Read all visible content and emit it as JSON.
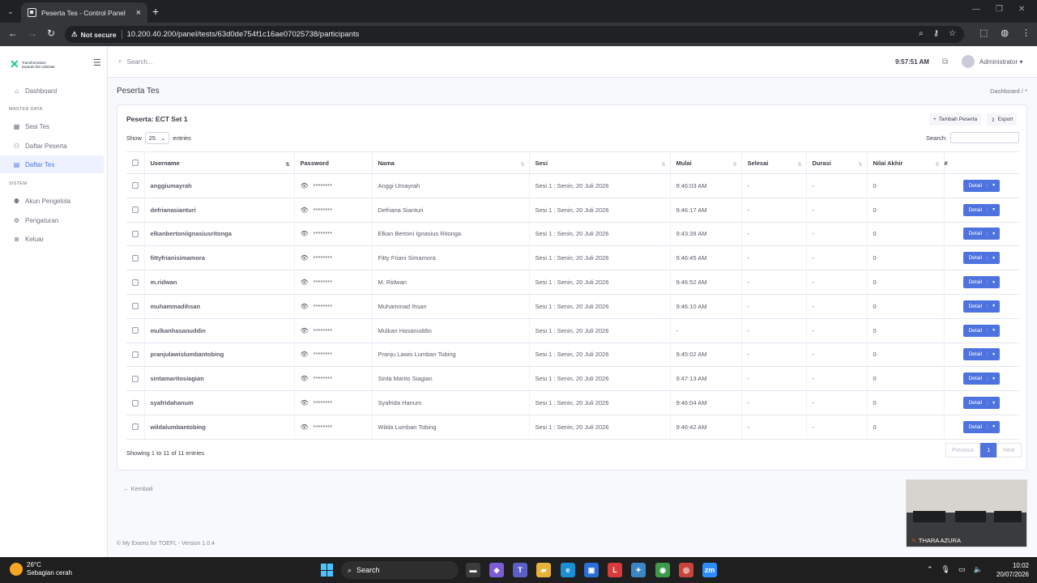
{
  "browser": {
    "tab_title": "Peserta Tes - Control Panel",
    "not_secure": "Not secure",
    "url": "10.200.40.200/panel/tests/63d0de754f1c16ae07025738/participants"
  },
  "sidebar": {
    "logo_line1": "Transformation",
    "logo_line2": "towards the Ultimate",
    "items": [
      {
        "label": "Dashboard",
        "icon": "home-icon"
      },
      {
        "label": "Sesi Tes",
        "icon": "calendar-icon"
      },
      {
        "label": "Daftar Peserta",
        "icon": "users-icon"
      },
      {
        "label": "Daftar Tes",
        "icon": "calendar-check-icon"
      },
      {
        "label": "Akun Pengelola",
        "icon": "user-cog-icon"
      },
      {
        "label": "Pengaturan",
        "icon": "gear-icon"
      },
      {
        "label": "Keluar",
        "icon": "logout-icon"
      }
    ],
    "heading_master": "MASTER DATA",
    "heading_system": "SISTEM"
  },
  "topbar": {
    "search_placeholder": "Search...",
    "clock": "9:57:51 AM",
    "user": "Administrator"
  },
  "page": {
    "title": "Peserta Tes",
    "breadcrumb": "Dashboard  /  *",
    "card_title": "Peserta: ECT Set 1",
    "add_button": "Tambah Peserta",
    "export_button": "Export",
    "show_label": "Show",
    "entries_value": "25",
    "entries_label": "entries",
    "search_label": "Search:",
    "info": "Showing 1 to 11 of 11 entries",
    "prev": "Previous",
    "page_no": "1",
    "next": "Next",
    "back": "Kembali",
    "footer": "© My Exams for TOEFL - Version 1.0.4"
  },
  "table": {
    "headers": [
      "Username",
      "Password",
      "Nama",
      "Sesi",
      "Mulai",
      "Selesai",
      "Durasi",
      "Nilai Akhir",
      "#"
    ],
    "detail_label": "Detail",
    "rows": [
      {
        "username": "anggiumayrah",
        "password": "********",
        "nama": "Anggi Umayrah",
        "sesi": "Sesi 1 : Senin, 20 Juli 2026",
        "mulai": "9:46:03 AM",
        "selesai": "-",
        "durasi": "-",
        "nilai": "0"
      },
      {
        "username": "defrianasianturi",
        "password": "********",
        "nama": "Defriana Sianturi",
        "sesi": "Sesi 1 : Senin, 20 Juli 2026",
        "mulai": "9:46:17 AM",
        "selesai": "-",
        "durasi": "-",
        "nilai": "0"
      },
      {
        "username": "elkanbertoniignasiusritonga",
        "password": "********",
        "nama": "Elkan Bertoni Ignasius Ritonga",
        "sesi": "Sesi 1 : Senin, 20 Juli 2026",
        "mulai": "9:43:39 AM",
        "selesai": "-",
        "durasi": "-",
        "nilai": "0"
      },
      {
        "username": "fittyfrianisimamora",
        "password": "********",
        "nama": "Fitty Friani Simamora",
        "sesi": "Sesi 1 : Senin, 20 Juli 2026",
        "mulai": "9:46:45 AM",
        "selesai": "-",
        "durasi": "-",
        "nilai": "0"
      },
      {
        "username": "m.ridwan",
        "password": "********",
        "nama": "M. Ridwan",
        "sesi": "Sesi 1 : Senin, 20 Juli 2026",
        "mulai": "9:46:52 AM",
        "selesai": "-",
        "durasi": "-",
        "nilai": "0"
      },
      {
        "username": "muhammadihsan",
        "password": "********",
        "nama": "Muhammad Ihsan",
        "sesi": "Sesi 1 : Senin, 20 Juli 2026",
        "mulai": "9:46:10 AM",
        "selesai": "-",
        "durasi": "-",
        "nilai": "0"
      },
      {
        "username": "mulkanhasanuddin",
        "password": "********",
        "nama": "Mulkan Hasanuddin",
        "sesi": "Sesi 1 : Senin, 20 Juli 2026",
        "mulai": "-",
        "selesai": "-",
        "durasi": "-",
        "nilai": "0"
      },
      {
        "username": "pranjulawislumbantobing",
        "password": "********",
        "nama": "Pranju Lawis Lumban Tobing",
        "sesi": "Sesi 1 : Senin, 20 Juli 2026",
        "mulai": "9:45:02 AM",
        "selesai": "-",
        "durasi": "-",
        "nilai": "0"
      },
      {
        "username": "sintamaritosiagian",
        "password": "********",
        "nama": "Sinta Marito Siagian",
        "sesi": "Sesi 1 : Senin, 20 Juli 2026",
        "mulai": "9:47:13 AM",
        "selesai": "-",
        "durasi": "-",
        "nilai": "0"
      },
      {
        "username": "syafridahanum",
        "password": "********",
        "nama": "Syafrida Hanum",
        "sesi": "Sesi 1 : Senin, 20 Juli 2026",
        "mulai": "9:46:04 AM",
        "selesai": "-",
        "durasi": "-",
        "nilai": "0"
      },
      {
        "username": "wildalumbantobing",
        "password": "********",
        "nama": "Wilda Lumban Tobing",
        "sesi": "Sesi 1 : Senin, 20 Juli 2026",
        "mulai": "9:46:42 AM",
        "selesai": "-",
        "durasi": "-",
        "nilai": "0"
      }
    ]
  },
  "video": {
    "name": "THARA AZURA"
  },
  "taskbar": {
    "temp": "26°C",
    "weather": "Sebagian cerah",
    "search": "Search",
    "time": "10:02",
    "date": "20/07/2026",
    "apps": [
      {
        "icon": "file-explorer-icon",
        "glyph": "▬",
        "color": "#3b3b3b"
      },
      {
        "icon": "copilot-icon",
        "glyph": "◆",
        "color": "#7b5cd6"
      },
      {
        "icon": "teams-icon",
        "glyph": "T",
        "color": "#5b5fc7"
      },
      {
        "icon": "folder-icon",
        "glyph": "▰",
        "color": "#e8b339"
      },
      {
        "icon": "edge-icon",
        "glyph": "e",
        "color": "#1b8fd4"
      },
      {
        "icon": "store-icon",
        "glyph": "▣",
        "color": "#2a6fd6"
      },
      {
        "icon": "launcher-icon",
        "glyph": "L",
        "color": "#d83b3b"
      },
      {
        "icon": "vscode-icon",
        "glyph": "✦",
        "color": "#3a87c8"
      },
      {
        "icon": "chrome-icon",
        "glyph": "◉",
        "color": "#3c9a4b"
      },
      {
        "icon": "camera-icon",
        "glyph": "◎",
        "color": "#c8453c"
      },
      {
        "icon": "zoom-icon",
        "glyph": "zm",
        "color": "#2d8cff"
      }
    ]
  },
  "colors": {
    "primary": "#4e73df",
    "sidebar_active_bg": "#eef2ff"
  }
}
